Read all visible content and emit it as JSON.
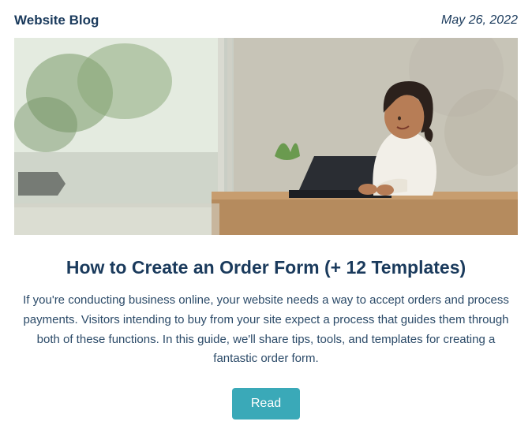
{
  "header": {
    "brand": "Website Blog",
    "date": "May 26, 2022"
  },
  "article": {
    "title": "How to Create an Order Form (+ 12 Templates)",
    "excerpt": "If you're conducting business online, your website needs a way to accept orders and process payments. Visitors intending to buy from your site expect a process that guides them through both of these functions. In this guide, we'll share tips, tools, and templates for creating a fantastic order form.",
    "cta_label": "Read"
  },
  "hero": {
    "alt": "Person typing on a laptop by a window"
  },
  "colors": {
    "text": "#1a3a5c",
    "accent": "#3aa9b8"
  }
}
